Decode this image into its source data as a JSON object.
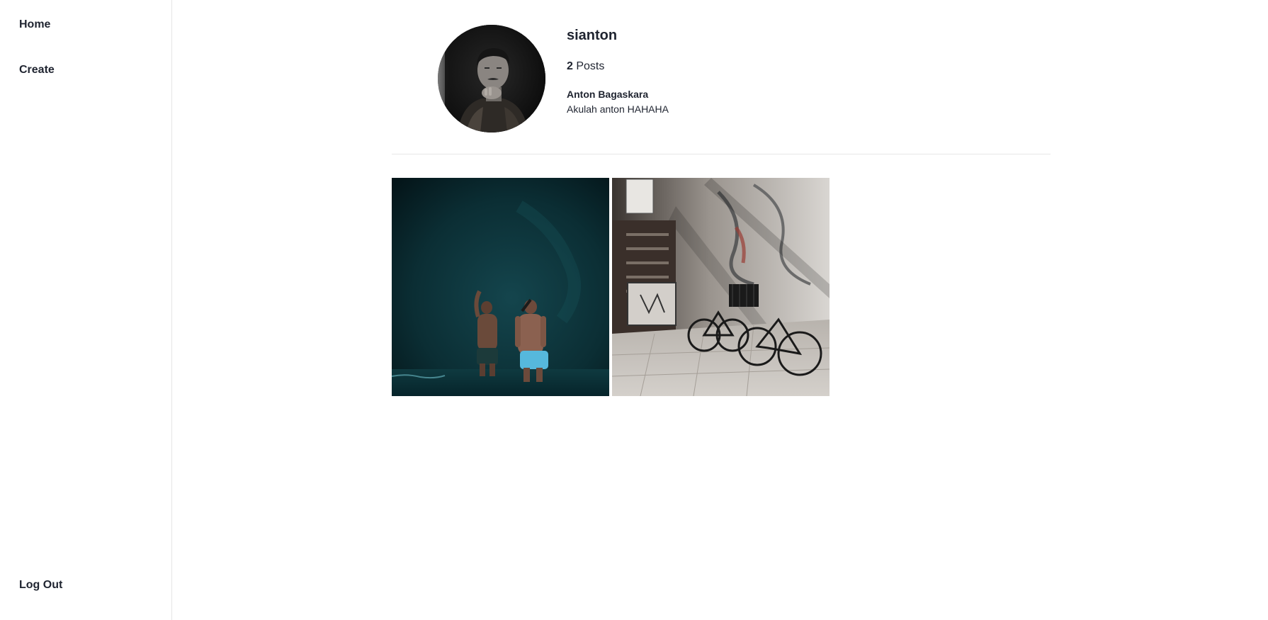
{
  "sidebar": {
    "home_label": "Home",
    "create_label": "Create",
    "logout_label": "Log Out"
  },
  "profile": {
    "username": "sianton",
    "post_count": "2",
    "post_count_label": "Posts",
    "full_name": "Anton Bagaskara",
    "bio": "Akulah anton HAHAHA"
  },
  "posts": [
    {
      "subject": "two men standing in dark teal water cave"
    },
    {
      "subject": "bicycles parked by graffiti wall and staircase"
    }
  ],
  "colors": {
    "text": "#1f2430",
    "border": "#e6e6e6",
    "background": "#ffffff"
  }
}
